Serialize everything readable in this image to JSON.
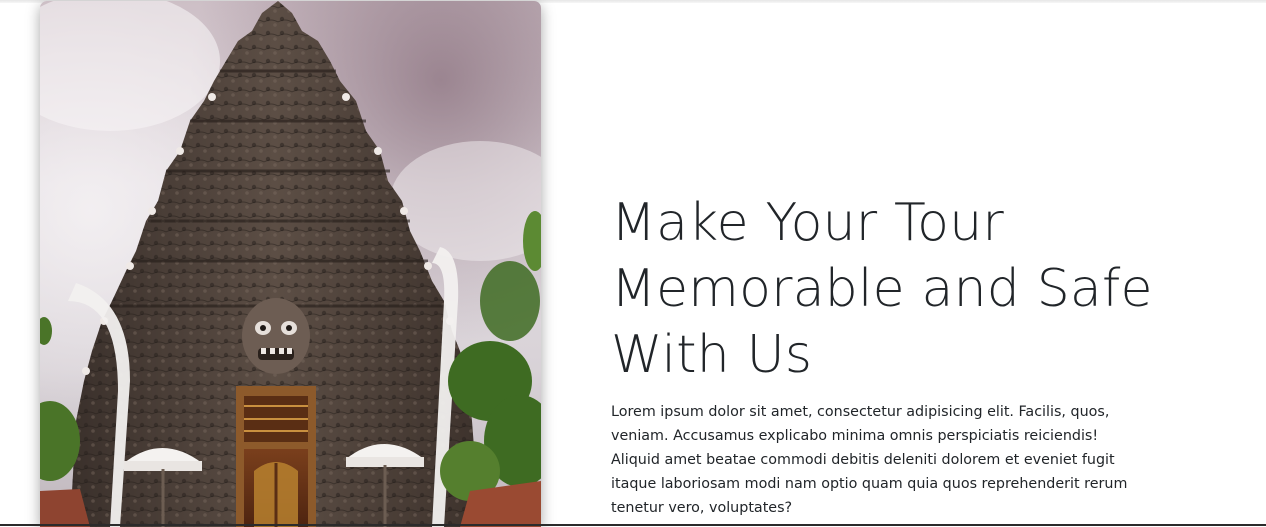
{
  "section": {
    "headline": "Make Your Tour Memorable and Safe With Us",
    "body": "Lorem ipsum dolor sit amet, consectetur adipisicing elit. Facilis, quos, veniam. Accusamus explicabo minima omnis perspiciatis reiciendis! Aliquid amet beatae commodi debitis deleniti dolorem et eveniet fugit itaque laboriosam modi nam optio quam quia quos reprehenderit rerum tenetur vero, voluptates?"
  },
  "image": {
    "subject": "balinese-temple-gate"
  },
  "colors": {
    "text": "#212529",
    "background": "#ffffff"
  }
}
